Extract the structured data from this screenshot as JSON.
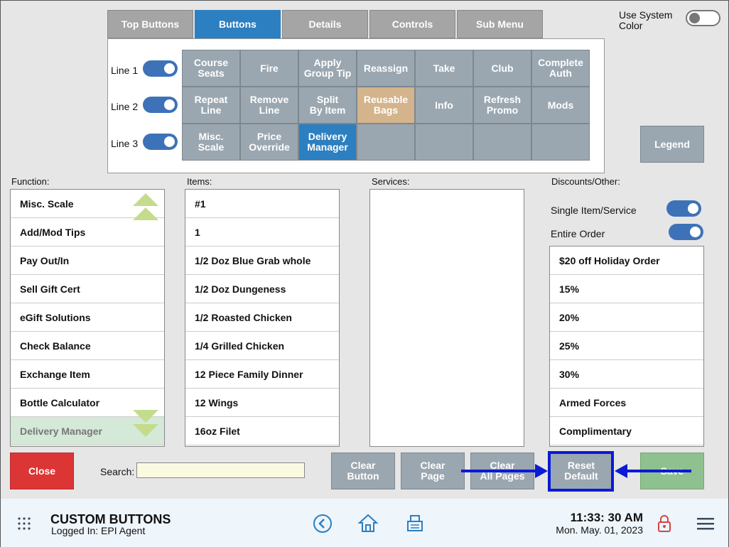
{
  "tabs": [
    "Top Buttons",
    "Buttons",
    "Details",
    "Controls",
    "Sub Menu"
  ],
  "system_color": {
    "label": "Use System\nColor",
    "on": false
  },
  "lines": [
    {
      "label": "Line 1",
      "on": true
    },
    {
      "label": "Line 2",
      "on": true
    },
    {
      "label": "Line 3",
      "on": true
    }
  ],
  "grid_buttons": [
    [
      "Course\nSeats",
      "Fire",
      "Apply\nGroup Tip",
      "Reassign",
      "Take",
      "Club",
      "Complete\nAuth"
    ],
    [
      "Repeat\nLine",
      "Remove\nLine",
      "Split\nBy Item",
      "Reusable\nBags",
      "Info",
      "Refresh\nPromo",
      "Mods"
    ],
    [
      "Misc.\nScale",
      "Price\nOverride",
      "Delivery\nManager",
      "",
      "",
      "",
      ""
    ]
  ],
  "legend_label": "Legend",
  "function": {
    "label": "Function:",
    "items": [
      "Misc. Scale",
      "Add/Mod Tips",
      "Pay Out/In",
      "Sell Gift Cert",
      "eGift Solutions",
      "Check Balance",
      "Exchange Item",
      "Bottle Calculator",
      "Delivery Manager"
    ]
  },
  "items": {
    "label": "Items:",
    "items": [
      "#1",
      "1",
      "1/2 Doz Blue Grab whole",
      "1/2 Doz Dungeness",
      "1/2 Roasted Chicken",
      "1/4 Grilled Chicken",
      "12 Piece Family Dinner",
      "12 Wings",
      "16oz Filet"
    ]
  },
  "services": {
    "label": "Services:"
  },
  "discounts": {
    "label": "Discounts/Other:",
    "single_label": "Single Item/Service",
    "entire_label": "Entire Order",
    "items": [
      "$20 off Holiday Order",
      "15%",
      "20%",
      "25%",
      "30%",
      "Armed Forces",
      "Complimentary"
    ]
  },
  "bottom": {
    "close": "Close",
    "search_label": "Search:",
    "search_value": "",
    "clear_button": "Clear\nButton",
    "clear_page": "Clear\nPage",
    "clear_all": "Clear\nAll Pages",
    "reset_default": "Reset\nDefault",
    "save": "Save"
  },
  "footer": {
    "title": "CUSTOM BUTTONS",
    "logged_in": "Logged In:  EPI Agent",
    "time": "11:33: 30 AM",
    "date": "Mon. May. 01, 2023"
  },
  "colors": {
    "accent": "#2c7fc0",
    "close": "#dc3535",
    "save": "#8fc08f",
    "highlight": "#0a1ad6"
  }
}
